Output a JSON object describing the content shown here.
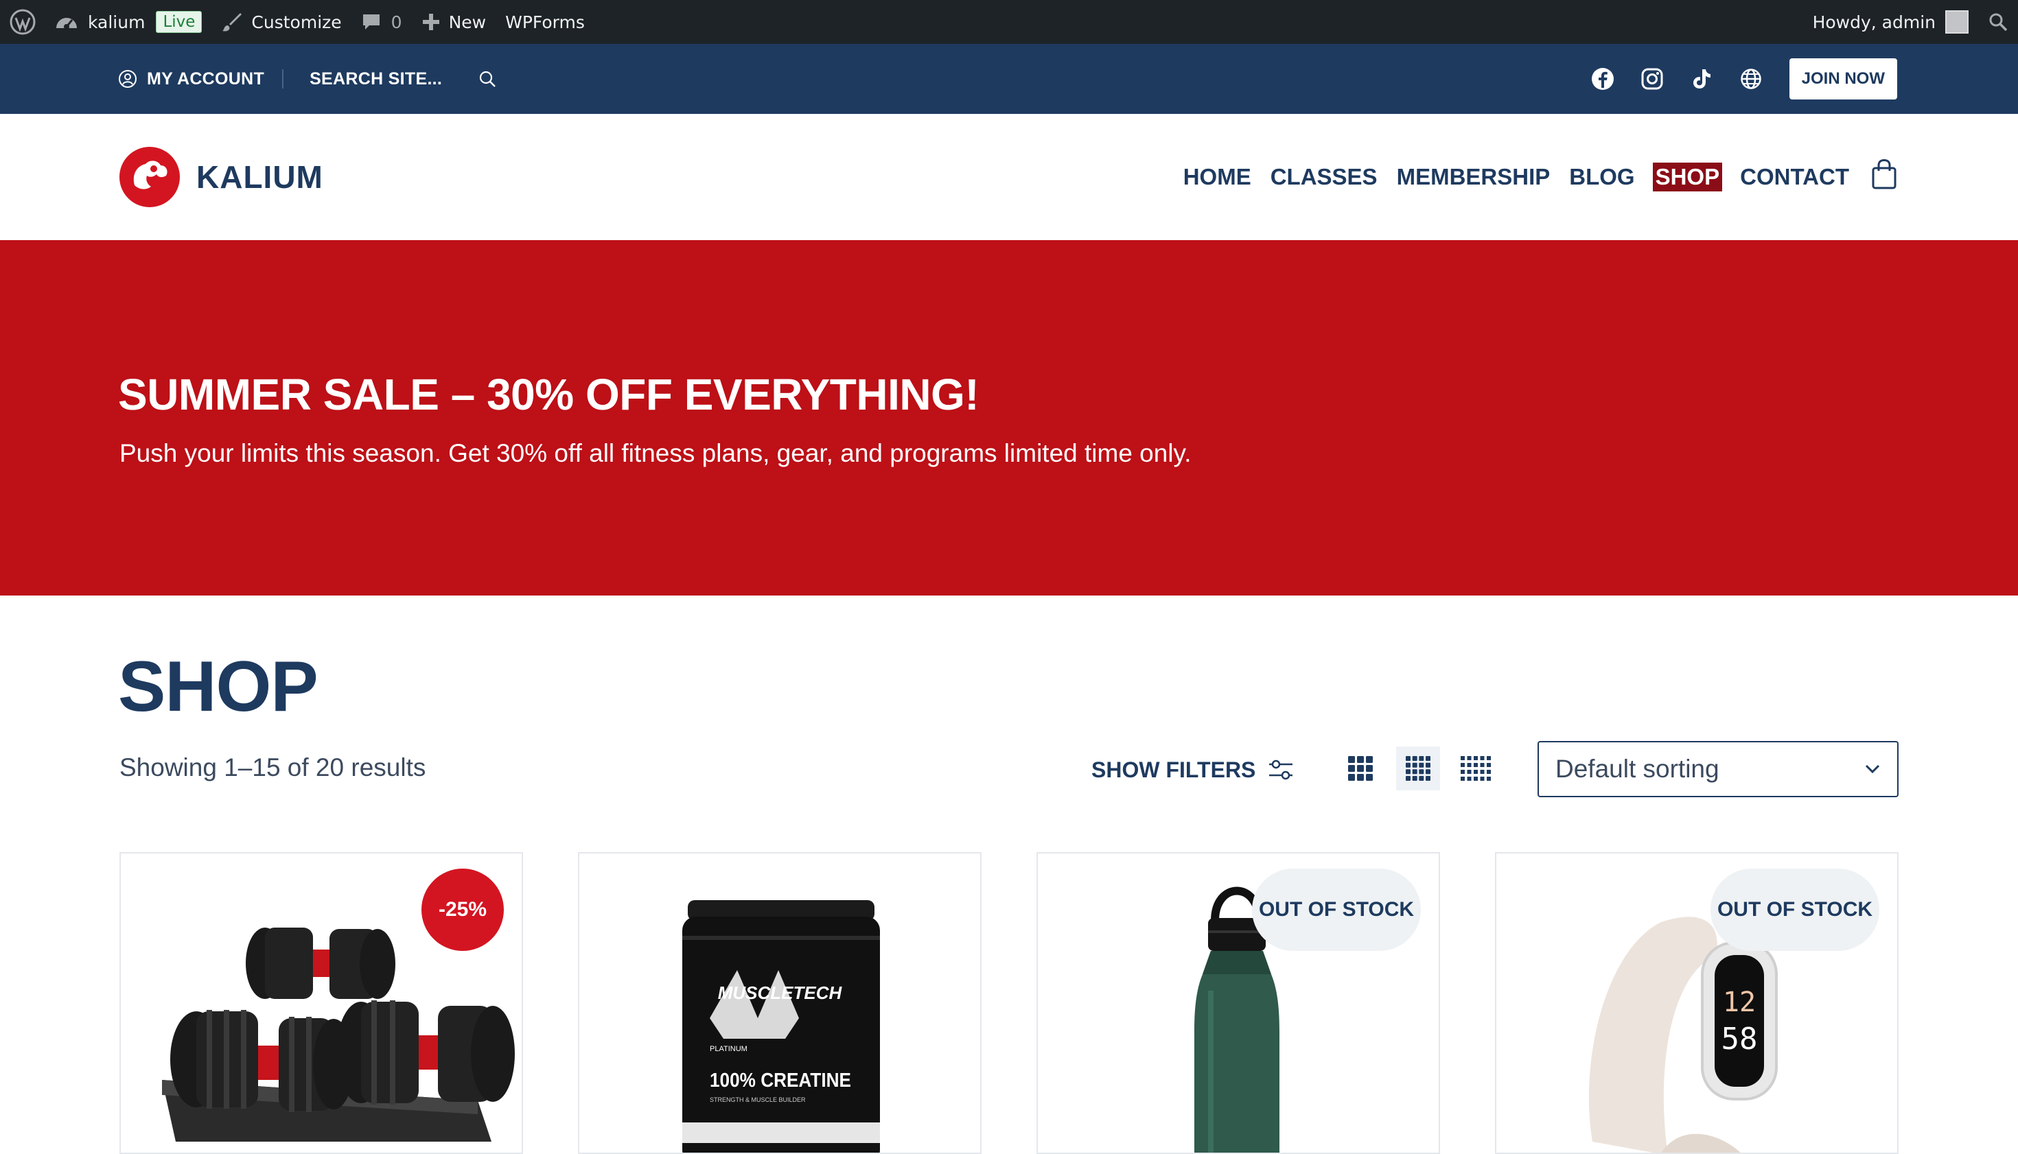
{
  "admin_bar": {
    "site_name": "kalium",
    "live_badge": "Live",
    "customize": "Customize",
    "comments_count": "0",
    "new_label": "New",
    "wpforms": "WPForms",
    "howdy": "Howdy, admin"
  },
  "topbar": {
    "account": "MY ACCOUNT",
    "search_placeholder": "SEARCH SITE...",
    "social_icons": [
      "facebook-icon",
      "instagram-icon",
      "tiktok-icon",
      "globe-icon"
    ],
    "join_button": "JOIN NOW"
  },
  "header": {
    "logo_text": "KALIUM",
    "nav": [
      {
        "label": "HOME",
        "active": false
      },
      {
        "label": "CLASSES",
        "active": false
      },
      {
        "label": "MEMBERSHIP",
        "active": false
      },
      {
        "label": "BLOG",
        "active": false
      },
      {
        "label": "SHOP",
        "active": true
      },
      {
        "label": "CONTACT",
        "active": false
      }
    ]
  },
  "hero": {
    "title": "SUMMER SALE – 30% OFF EVERYTHING!",
    "subtitle": "Push your limits this season. Get 30% off all fitness plans, gear, and programs limited time only."
  },
  "shop": {
    "title": "SHOP",
    "results": "Showing 1–15 of 20 results",
    "show_filters": "SHOW FILTERS",
    "grid_options": [
      "3-columns",
      "4-columns",
      "5-columns"
    ],
    "selected_grid": "4-columns",
    "sorting": "Default sorting"
  },
  "products": [
    {
      "image": "adjustable-dumbbells",
      "badge": "-25%",
      "badge_type": "sale"
    },
    {
      "image": "creatine-tub",
      "badge": "",
      "badge_type": "none",
      "packaging_text": {
        "brand": "MUSCLETECH",
        "tier": "PLATINUM",
        "name": "100% CREATINE",
        "tagline": "STRENGTH & MUSCLE BUILDER"
      }
    },
    {
      "image": "water-bottle",
      "badge": "OUT OF STOCK",
      "badge_type": "oos"
    },
    {
      "image": "fitness-tracker",
      "badge": "OUT OF STOCK",
      "badge_type": "oos",
      "screen_text": {
        "hours": "12",
        "minutes": "58"
      }
    }
  ],
  "colors": {
    "admin_bar_bg": "#1d2327",
    "topbar_bg": "#1e3a5f",
    "brand_navy": "#1e3a5f",
    "hero_red": "#bd1017",
    "active_nav_bg": "#8b0d17",
    "sale_badge": "#d31521"
  }
}
